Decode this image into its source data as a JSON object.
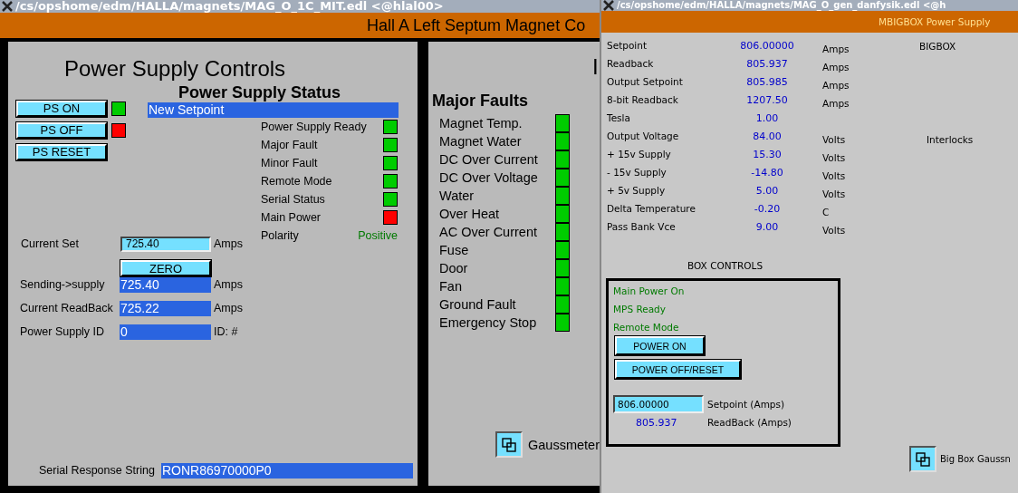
{
  "left_window": {
    "title": "/cs/opshome/edm/HALLA/magnets/MAG_O_1C_MIT.edl <@hlal00>",
    "banner": "Hall A Left Septum Magnet Co",
    "controls_panel": {
      "title": "Power Supply Controls",
      "buttons": [
        {
          "label": "PS ON",
          "color": "#00cc00"
        },
        {
          "label": "PS OFF",
          "color": "#ff0000"
        },
        {
          "label": "PS RESET"
        }
      ],
      "status_title": "Power Supply Status",
      "status_message": "New Setpoint",
      "status": [
        {
          "label": "Power Supply Ready",
          "color": "#00cc00"
        },
        {
          "label": "Major Fault",
          "color": "#00cc00"
        },
        {
          "label": "Minor Fault",
          "color": "#00cc00"
        },
        {
          "label": "Remote Mode",
          "color": "#00cc00"
        },
        {
          "label": "Serial Status",
          "color": "#00cc00"
        },
        {
          "label": "Main Power",
          "color": "#ff0000"
        }
      ],
      "polarity": {
        "label": "Polarity",
        "value": "Positive"
      },
      "current_set": {
        "label": "Current Set",
        "value": "725.40",
        "unit": "Amps"
      },
      "zero_button": "ZERO",
      "readouts": [
        {
          "label": "Sending->supply",
          "value": "725.40",
          "unit": "Amps"
        },
        {
          "label": "Current ReadBack",
          "value": "725.22",
          "unit": "Amps"
        },
        {
          "label": "Power Supply ID",
          "value": "0",
          "unit": "ID: #"
        }
      ],
      "serial": {
        "label": "Serial Response String",
        "value": "RONR86970000P0"
      }
    },
    "faults_panel": {
      "title_fragment": "I",
      "title": "Major Faults",
      "faults": [
        {
          "label": "Magnet Temp.",
          "color": "#00cc00"
        },
        {
          "label": "Magnet Water",
          "color": "#00cc00"
        },
        {
          "label": "DC Over Current",
          "color": "#00cc00"
        },
        {
          "label": "DC Over Voltage",
          "color": "#00cc00"
        },
        {
          "label": "Water",
          "color": "#00cc00"
        },
        {
          "label": "Over Heat",
          "color": "#00cc00"
        },
        {
          "label": "AC Over Current",
          "color": "#00cc00"
        },
        {
          "label": "Fuse",
          "color": "#00cc00"
        },
        {
          "label": "Door",
          "color": "#00cc00"
        },
        {
          "label": "Fan",
          "color": "#00cc00"
        },
        {
          "label": "Ground Fault",
          "color": "#00cc00"
        },
        {
          "label": "Emergency Stop",
          "color": "#00cc00"
        }
      ],
      "gaussmeter_label": "Gaussmeter"
    }
  },
  "right_window": {
    "title": "/cs/opshome/edm/HALLA/magnets/MAG_O_gen_danfysik.edl <@h",
    "banner": "MBIGBOX Power Supply",
    "readings": [
      {
        "label": "Setpoint",
        "value": "806.00000",
        "unit": "Amps"
      },
      {
        "label": "Readback",
        "value": "805.937",
        "unit": "Amps"
      },
      {
        "label": "Output Setpoint",
        "value": "805.985",
        "unit": "Amps"
      },
      {
        "label": "8-bit Readback",
        "value": "1207.50",
        "unit": "Amps"
      },
      {
        "label": "Tesla",
        "value": "1.00"
      },
      {
        "label": "Output Voltage",
        "value": "84.00",
        "unit": "Volts"
      },
      {
        "label": "+ 15v Supply",
        "value": "15.30",
        "unit": "Volts"
      },
      {
        "label": "- 15v Supply",
        "value": "-14.80",
        "unit": "Volts"
      },
      {
        "label": "+ 5v Supply",
        "value": "5.00",
        "unit": "Volts"
      },
      {
        "label": "Delta Temperature",
        "value": "-0.20",
        "unit": "C"
      },
      {
        "label": "Pass Bank Vce",
        "value": "9.00",
        "unit": "Volts"
      }
    ],
    "side_title": "BIGBOX",
    "interlocks_label": "Interlocks",
    "box_controls": {
      "title": "BOX CONTROLS",
      "indicators": [
        "Main Power On",
        "MPS Ready",
        "Remote Mode"
      ],
      "buttons": [
        "POWER ON",
        "POWER OFF/RESET"
      ],
      "setpoint": {
        "value": "806.00000",
        "label": "Setpoint (Amps)"
      },
      "readback": {
        "value": "805.937",
        "label": "ReadBack (Amps)"
      }
    },
    "gaussmeter_label": "Big Box Gaussn"
  }
}
